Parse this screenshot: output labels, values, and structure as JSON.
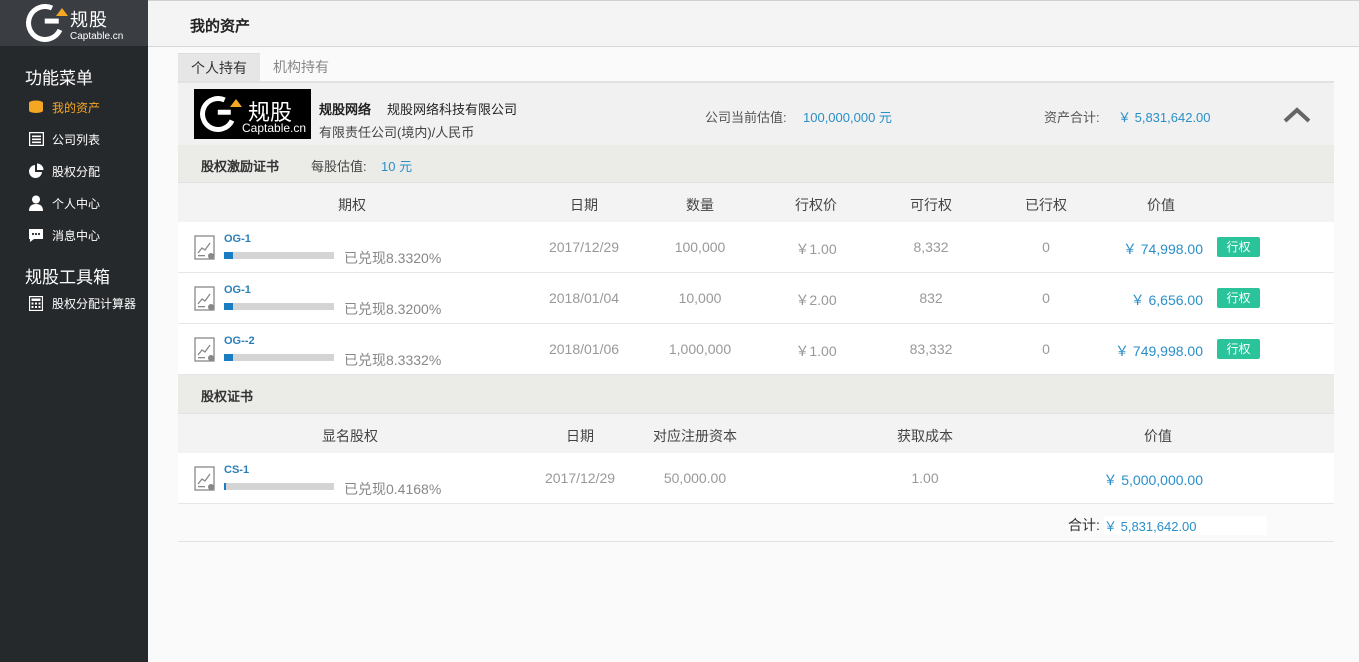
{
  "sidebar": {
    "logo_cn": "规股",
    "logo_en": "Captable.cn",
    "menu_title": "功能菜单",
    "menu_items": [
      {
        "label": "我的资产",
        "icon": "coins-icon",
        "active": true
      },
      {
        "label": "公司列表",
        "icon": "list-icon",
        "active": false
      },
      {
        "label": "股权分配",
        "icon": "pie-chart-icon",
        "active": false
      },
      {
        "label": "个人中心",
        "icon": "user-icon",
        "active": false
      },
      {
        "label": "消息中心",
        "icon": "message-icon",
        "active": false
      }
    ],
    "tools_title": "规股工具箱",
    "tools_items": [
      {
        "label": "股权分配计算器",
        "icon": "calculator-icon"
      }
    ]
  },
  "header": {
    "title": "我的资产"
  },
  "tabs": [
    "个人持有",
    "机构持有"
  ],
  "company": {
    "logo_cn": "规股",
    "logo_en": "Captable.cn",
    "short_name": "规股网络",
    "full_name": "规股网络科技有限公司",
    "type": "有限责任公司(境内)/人民币",
    "valuation_label": "公司当前估值:",
    "valuation_value": "100,000,000 元",
    "total_label": "资产合计:",
    "total_value": "￥ 5,831,642.00"
  },
  "options_section": {
    "title": "股权激励证书",
    "price_label": "每股估值:",
    "price_value": "10 元",
    "columns": [
      "期权",
      "日期",
      "数量",
      "行权价",
      "可行权",
      "已行权",
      "价值"
    ],
    "rows": [
      {
        "code": "OG-1",
        "progress": 0.08332,
        "pct": "已兑现8.3320%",
        "date": "2017/12/29",
        "qty": "100,000",
        "strike": "￥1.00",
        "exercisable": "8,332",
        "exercised": "0",
        "value": "￥ 74,998.00",
        "button": "行权"
      },
      {
        "code": "OG-1",
        "progress": 0.0832,
        "pct": "已兑现8.3200%",
        "date": "2018/01/04",
        "qty": "10,000",
        "strike": "￥2.00",
        "exercisable": "832",
        "exercised": "0",
        "value": "￥ 6,656.00",
        "button": "行权"
      },
      {
        "code": "OG--2",
        "progress": 0.08332,
        "pct": "已兑现8.3332%",
        "date": "2018/01/06",
        "qty": "1,000,000",
        "strike": "￥1.00",
        "exercisable": "83,332",
        "exercised": "0",
        "value": "￥ 749,998.00",
        "button": "行权"
      }
    ]
  },
  "equity_section": {
    "title": "股权证书",
    "columns": [
      "显名股权",
      "日期",
      "对应注册资本",
      "获取成本",
      "价值"
    ],
    "rows": [
      {
        "code": "CS-1",
        "progress": 0.004168,
        "pct": "已兑现0.4168%",
        "date": "2017/12/29",
        "capital": "50,000.00",
        "cost": "1.00",
        "value": "￥ 5,000,000.00"
      }
    ]
  },
  "summary": {
    "label": "合计:",
    "value": "￥ 5,831,642.00"
  },
  "colors": {
    "accent": "#2a8fc8",
    "active_menu": "#f5a623",
    "button": "#2bc49a",
    "sidebar": "#26292c"
  }
}
